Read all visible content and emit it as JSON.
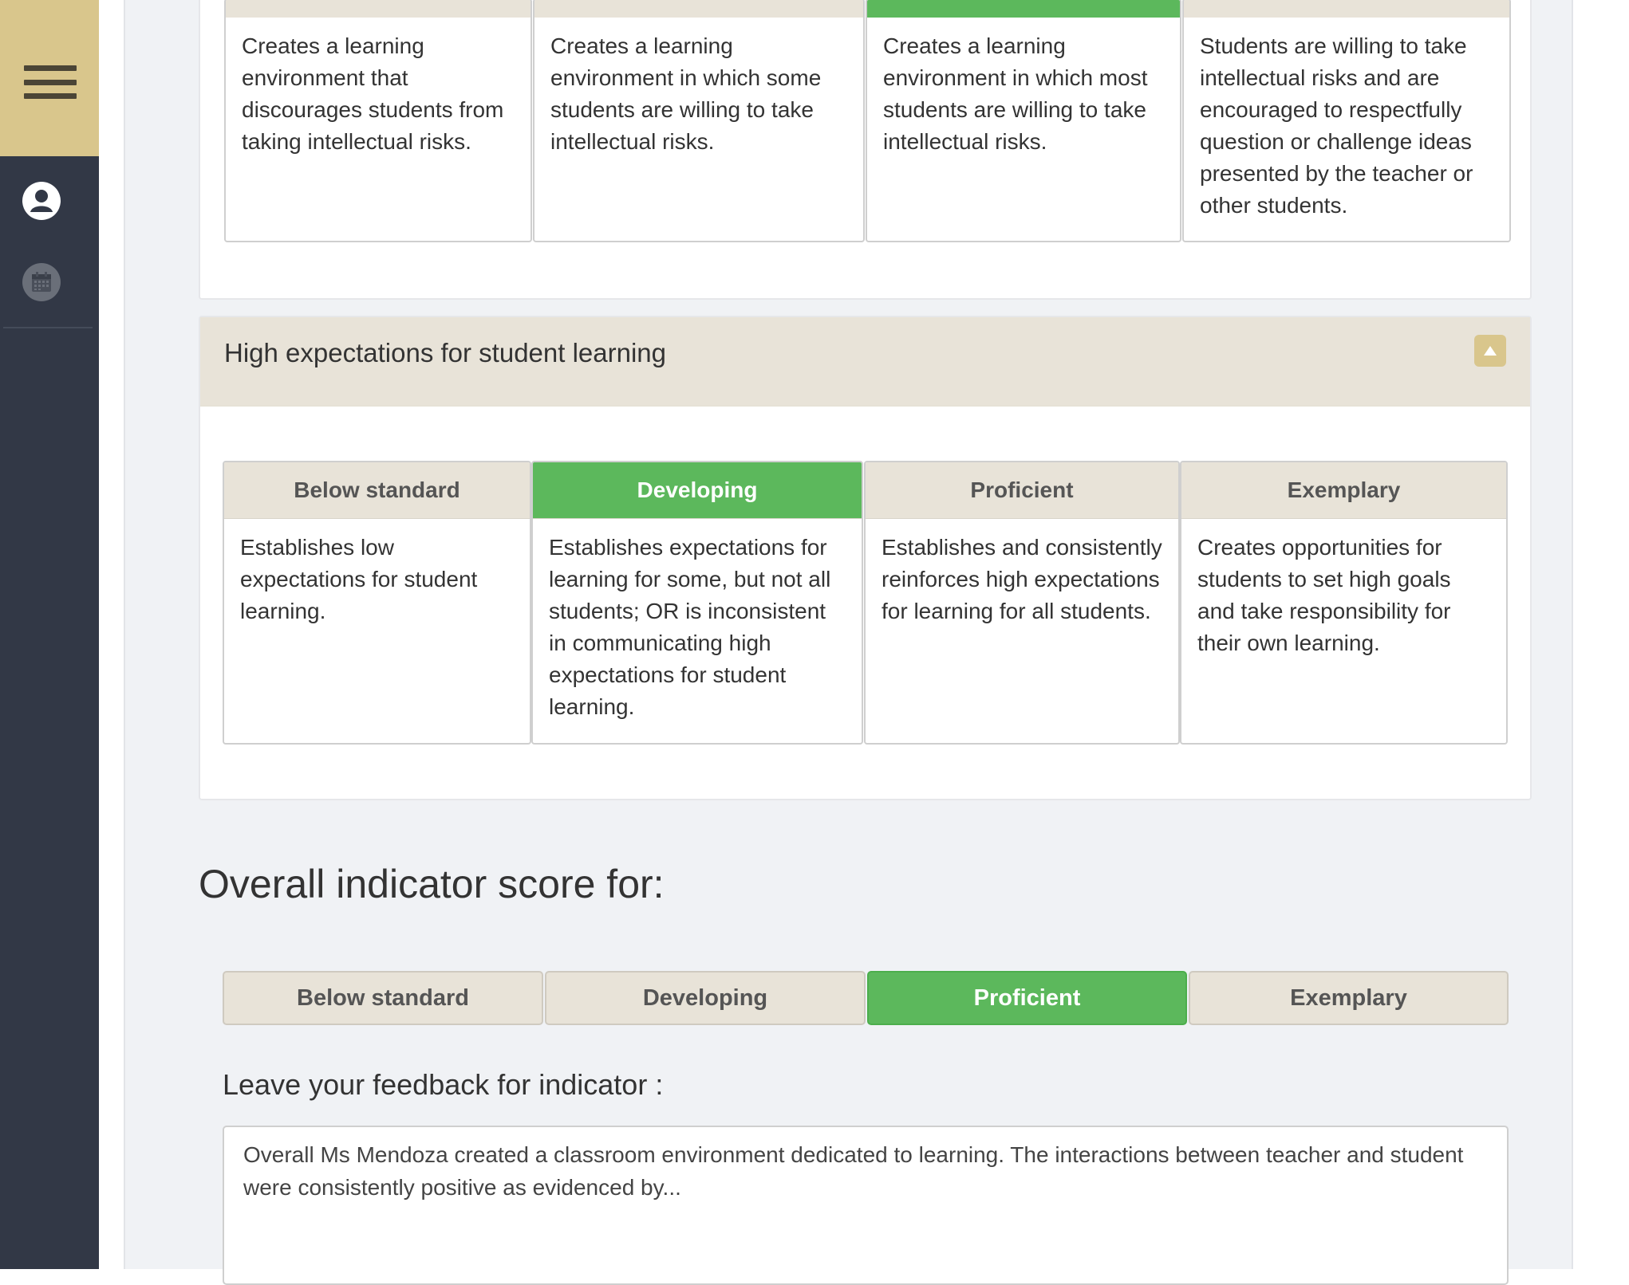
{
  "sidebar": {
    "menu_icon": "hamburger-menu-icon",
    "icons": [
      "user-icon",
      "calendar-icon"
    ],
    "colors": {
      "background": "#323846",
      "menu_box": "#d9c68c"
    }
  },
  "top_section": {
    "levels": [
      {
        "text": "Creates a learning environment that discourages students from taking intellectual risks."
      },
      {
        "text": "Creates a learning environment in which some students are willing to take intellectual risks."
      },
      {
        "text": "Creates a learning environment in which most students are willing to take intellectual risks.",
        "selected": true
      },
      {
        "text": "Students are willing to take intellectual risks and are encouraged to respectfully question or challenge ideas presented by the teacher or other students."
      }
    ]
  },
  "expectations_section": {
    "title": "High expectations for student learning",
    "collapse_icon": "triangle-up-icon",
    "levels": [
      {
        "label": "Below standard",
        "text": "Establishes low expectations for student learning."
      },
      {
        "label": "Developing",
        "text": "Establishes expectations for learning for some, but not all students; OR is inconsistent in communicating high expectations for student learning.",
        "selected": true
      },
      {
        "label": "Proficient",
        "text": "Establishes and consistently reinforces high expectations for learning for all students."
      },
      {
        "label": "Exemplary",
        "text": "Creates opportunities for students to set high goals and take responsibility for their own learning."
      }
    ]
  },
  "overall": {
    "heading": "Overall indicator score for:",
    "options": [
      "Below standard",
      "Developing",
      "Proficient",
      "Exemplary"
    ],
    "selected": "Proficient"
  },
  "feedback": {
    "label": "Leave your feedback for indicator :",
    "value": "Overall Ms Mendoza created a classroom environment dedicated to learning. The interactions between teacher and student were consistently positive as evidenced by..."
  },
  "colors": {
    "selected": "#5cb85c",
    "level_header": "#e8e3d8",
    "accent": "#d9c68c"
  }
}
